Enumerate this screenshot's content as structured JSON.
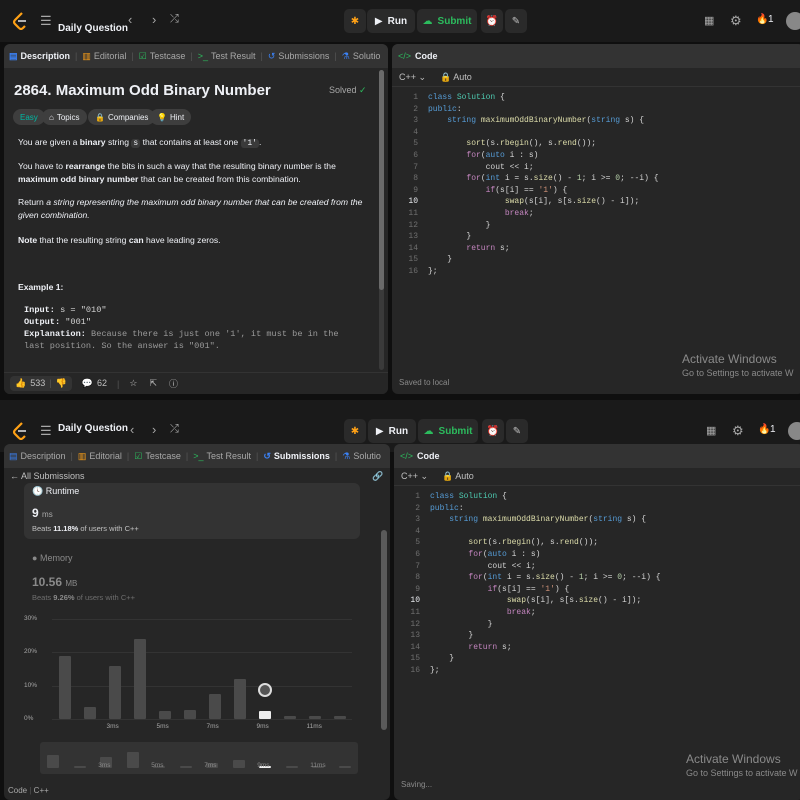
{
  "topbar": {
    "title": "Daily Question",
    "run": "Run",
    "submit": "Submit",
    "streak": "1"
  },
  "shot1": {
    "tabs": [
      "Description",
      "Editorial",
      "Testcase",
      "Test Result",
      "Submissions",
      "Solutio"
    ],
    "problem_title": "2864. Maximum Odd Binary Number",
    "solved": "Solved",
    "tags": [
      "Easy",
      "Topics",
      "Companies",
      "Hint"
    ],
    "p1_a": "You are given a ",
    "p1_b": "binary",
    "p1_c": " string ",
    "p1_d": "s",
    "p1_e": " that contains at least one ",
    "p1_f": "'1'",
    "p1_g": ".",
    "p2_a": "You have to ",
    "p2_b": "rearrange",
    "p2_c": " the bits in such a way that the resulting binary number is the ",
    "p2_d": "maximum odd binary number",
    "p2_e": " that can be created from this combination.",
    "p3_a": "Return ",
    "p3_b": "a string representing the maximum odd binary number that can be created from the given combination.",
    "p4_a": "Note",
    "p4_b": " that the resulting string ",
    "p4_c": "can",
    "p4_d": " have leading zeros.",
    "example_title": "Example 1:",
    "input_label": "Input:",
    "input_val": " s = \"010\"",
    "output_label": "Output:",
    "output_val": " \"001\"",
    "expl_label": "Explanation:",
    "expl_val": " Because there is just one '1', it must be in the last position. So the answer is \"001\".",
    "likes": "533",
    "comments": "62",
    "code_tab": "Code",
    "lang": "C++",
    "auto": "Auto",
    "saved": "Saved to local",
    "activate_title": "Activate Windows",
    "activate_sub": "Go to Settings to activate W"
  },
  "shot2": {
    "tabs": [
      "Description",
      "Editorial",
      "Testcase",
      "Test Result",
      "Submissions",
      "Solutio"
    ],
    "back": "All Submissions",
    "runtime_label": "Runtime",
    "runtime_val": "9",
    "runtime_unit": "ms",
    "runtime_beats_a": "Beats ",
    "runtime_beats_b": "11.18%",
    "runtime_beats_c": " of users with C++",
    "memory_label": "Memory",
    "memory_val": "10.56",
    "memory_unit": "MB",
    "memory_beats_a": "Beats ",
    "memory_beats_b": "9.26%",
    "memory_beats_c": " of users with C++",
    "code_tab": "Code",
    "lang": "C++",
    "auto": "Auto",
    "saving": "Saving...",
    "footer_code": "Code",
    "footer_lang": "C++",
    "activate_title": "Activate Windows",
    "activate_sub": "Go to Settings to activate W"
  },
  "code": [
    "class Solution {",
    "public:",
    "    string maximumOddBinaryNumber(string s) {",
    "",
    "        sort(s.rbegin(), s.rend());",
    "        for(auto i : s)",
    "            cout << i;",
    "        for(int i = s.size() - 1; i >= 0; --i) {",
    "            if(s[i] == '1') {",
    "                swap(s[i], s[s.size() - i]);",
    "                break;",
    "            }",
    "        }",
    "        return s;",
    "    }",
    "};"
  ],
  "line_numbers": [
    "1",
    "2",
    "3",
    "4",
    "5",
    "6",
    "7",
    "8",
    "9",
    "10",
    "11",
    "12",
    "13",
    "14",
    "15",
    "16"
  ],
  "chart_data": {
    "type": "bar",
    "ylabels": [
      "30%",
      "20%",
      "10%",
      "0%"
    ],
    "xlabels": [
      "3ms",
      "5ms",
      "7ms",
      "9ms",
      "11ms"
    ],
    "values": [
      19,
      3.5,
      16,
      24,
      2.3,
      2.8,
      7.5,
      12,
      2.5,
      1,
      1,
      1
    ],
    "highlight_index": 8,
    "ylim": [
      0,
      30
    ]
  }
}
